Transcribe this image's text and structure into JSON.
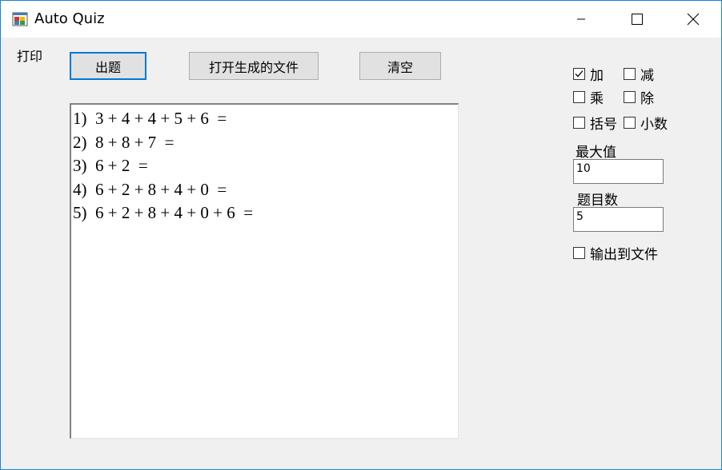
{
  "window": {
    "title": "Auto Quiz",
    "icon": "winforms-app-icon",
    "controls": [
      "minimize-icon",
      "maximize-icon",
      "close-icon"
    ]
  },
  "menu": {
    "print_label": "打印"
  },
  "toolbar": {
    "generate_label": "出题",
    "open_file_label": "打开生成的文件",
    "clear_label": "清空"
  },
  "output": {
    "lines": [
      "1)  3 + 4 + 4 + 5 + 6  =",
      "2)  8 + 8 + 7  =",
      "3)  6 + 2  =",
      "4)  6 + 2 + 8 + 4 + 0  =",
      "5)  6 + 2 + 8 + 4 + 0 + 6  ="
    ]
  },
  "options": {
    "add": {
      "label": "加",
      "checked": true
    },
    "subtract": {
      "label": "减",
      "checked": false
    },
    "multiply": {
      "label": "乘",
      "checked": false
    },
    "divide": {
      "label": "除",
      "checked": false
    },
    "brackets": {
      "label": "括号",
      "checked": false
    },
    "decimals": {
      "label": "小数",
      "checked": false
    },
    "max_value_label": "最大值",
    "max_value": "10",
    "count_label": "题目数",
    "count": "5",
    "output_to_file": {
      "label": "输出到文件",
      "checked": false
    }
  },
  "colors": {
    "window_border": "#1883d7",
    "form_background": "#f0f0f0",
    "default_button_border": "#0078d7"
  }
}
